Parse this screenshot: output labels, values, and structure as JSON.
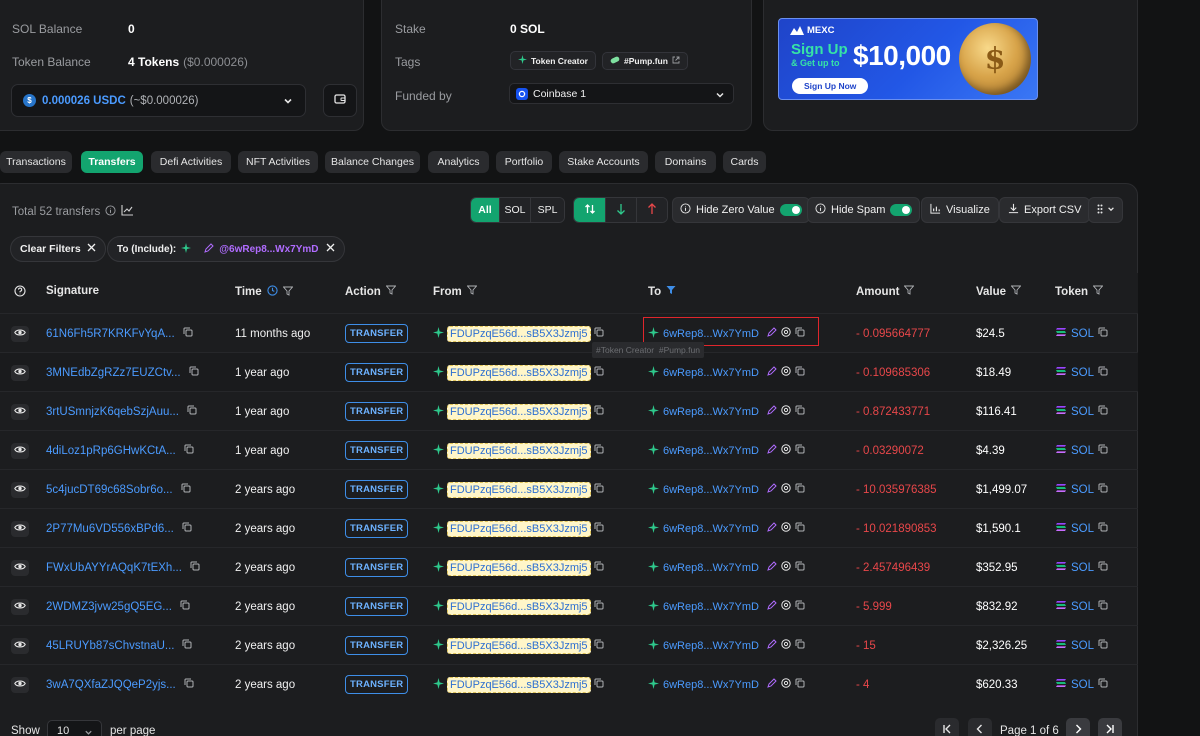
{
  "top_left": {
    "sol_balance_label": "SOL Balance",
    "sol_balance_value": "0",
    "token_balance_label": "Token Balance",
    "token_balance_value": "4 Tokens",
    "token_balance_usd": "($0.000026)",
    "token_select_amount": "0.000026 USDC",
    "token_select_usd": "(~$0.000026)"
  },
  "top_mid": {
    "stake_label": "Stake",
    "stake_value": "0 SOL",
    "tags_label": "Tags",
    "tag_1": "Token Creator",
    "tag_2": "#Pump.fun",
    "funded_label": "Funded by",
    "funded_value": "Coinbase 1"
  },
  "ad": {
    "brand": "MEXC",
    "line1": "Sign Up",
    "line2": "& Get up to",
    "amount": "$10,000",
    "cta": "Sign Up Now"
  },
  "tabs": [
    {
      "label": "Transactions",
      "active": false
    },
    {
      "label": "Transfers",
      "active": true
    },
    {
      "label": "Defi Activities",
      "active": false
    },
    {
      "label": "NFT Activities",
      "active": false
    },
    {
      "label": "Balance Changes",
      "active": false
    },
    {
      "label": "Analytics",
      "active": false
    },
    {
      "label": "Portfolio",
      "active": false
    },
    {
      "label": "Stake Accounts",
      "active": false
    },
    {
      "label": "Domains",
      "active": false
    },
    {
      "label": "Cards",
      "active": false
    }
  ],
  "toolbar": {
    "total_text": "Total 52 transfers",
    "seg_all": "All",
    "seg_sol": "SOL",
    "seg_spl": "SPL",
    "hide_zero": "Hide Zero Value",
    "hide_spam": "Hide Spam",
    "visualize": "Visualize",
    "export": "Export CSV"
  },
  "filters": {
    "clear": "Clear Filters",
    "to_include": "To (Include):",
    "to_addr": "@6wRep8...Wx7YmD"
  },
  "columns": {
    "signature": "Signature",
    "time": "Time",
    "action": "Action",
    "from": "From",
    "to": "To",
    "amount": "Amount",
    "value": "Value",
    "token": "Token"
  },
  "tooltip": "#Token Creator  #Pump.fun",
  "rows": [
    {
      "sig": "61N6Fh5R7KRKFvYqA...",
      "time": "11 months ago",
      "action": "TRANSFER",
      "from": "FDUPzqE56d...sB5X3Jzmj5",
      "to": "6wRep8...Wx7YmD",
      "amount": "- 0.095664777",
      "value": "$24.5",
      "token": "SOL"
    },
    {
      "sig": "3MNEdbZgRZz7EUZCtv...",
      "time": "1 year ago",
      "action": "TRANSFER",
      "from": "FDUPzqE56d...sB5X3Jzmj5",
      "to": "6wRep8...Wx7YmD",
      "amount": "- 0.109685306",
      "value": "$18.49",
      "token": "SOL"
    },
    {
      "sig": "3rtUSmnjzK6qebSzjAuu...",
      "time": "1 year ago",
      "action": "TRANSFER",
      "from": "FDUPzqE56d...sB5X3Jzmj5",
      "to": "6wRep8...Wx7YmD",
      "amount": "- 0.872433771",
      "value": "$116.41",
      "token": "SOL"
    },
    {
      "sig": "4diLoz1pRp6GHwKCtA...",
      "time": "1 year ago",
      "action": "TRANSFER",
      "from": "FDUPzqE56d...sB5X3Jzmj5",
      "to": "6wRep8...Wx7YmD",
      "amount": "- 0.03290072",
      "value": "$4.39",
      "token": "SOL"
    },
    {
      "sig": "5c4jucDT69c68Sobr6o...",
      "time": "2 years ago",
      "action": "TRANSFER",
      "from": "FDUPzqE56d...sB5X3Jzmj5",
      "to": "6wRep8...Wx7YmD",
      "amount": "- 10.035976385",
      "value": "$1,499.07",
      "token": "SOL"
    },
    {
      "sig": "2P77Mu6VD556xBPd6...",
      "time": "2 years ago",
      "action": "TRANSFER",
      "from": "FDUPzqE56d...sB5X3Jzmj5",
      "to": "6wRep8...Wx7YmD",
      "amount": "- 10.021890853",
      "value": "$1,590.1",
      "token": "SOL"
    },
    {
      "sig": "FWxUbAYYrAQqK7tEXh...",
      "time": "2 years ago",
      "action": "TRANSFER",
      "from": "FDUPzqE56d...sB5X3Jzmj5",
      "to": "6wRep8...Wx7YmD",
      "amount": "- 2.457496439",
      "value": "$352.95",
      "token": "SOL"
    },
    {
      "sig": "2WDMZ3jvw25gQ5EG...",
      "time": "2 years ago",
      "action": "TRANSFER",
      "from": "FDUPzqE56d...sB5X3Jzmj5",
      "to": "6wRep8...Wx7YmD",
      "amount": "- 5.999",
      "value": "$832.92",
      "token": "SOL"
    },
    {
      "sig": "45LRUYb87sChvstnaU...",
      "time": "2 years ago",
      "action": "TRANSFER",
      "from": "FDUPzqE56d...sB5X3Jzmj5",
      "to": "6wRep8...Wx7YmD",
      "amount": "- 15",
      "value": "$2,326.25",
      "token": "SOL"
    },
    {
      "sig": "3wA7QXfaZJQQeP2yjs...",
      "time": "2 years ago",
      "action": "TRANSFER",
      "from": "FDUPzqE56d...sB5X3Jzmj5",
      "to": "6wRep8...Wx7YmD",
      "amount": "- 4",
      "value": "$620.33",
      "token": "SOL"
    }
  ],
  "pagination": {
    "show": "Show",
    "per_page_value": "10",
    "per_page": "per page",
    "page_text": "Page 1 of 6"
  },
  "colors": {
    "accent_green": "#13a46f",
    "link_blue": "#4b9bff",
    "negative_red": "#e8474a",
    "highlight_box": "#e0262c"
  }
}
